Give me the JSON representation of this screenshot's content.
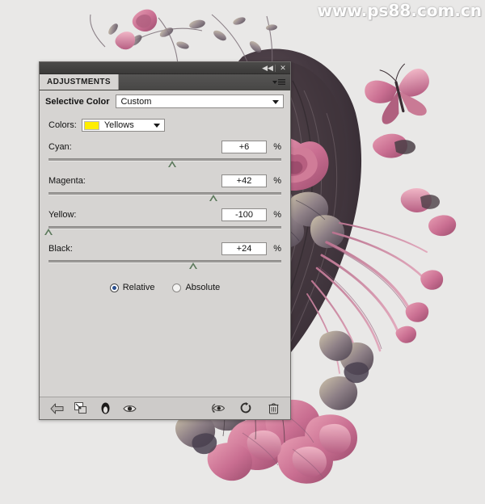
{
  "watermark": {
    "text": "www.ps88.com.cn"
  },
  "panel": {
    "titlebar": {
      "collapse_icon": "collapse-double-left-icon",
      "collapse_glyph": "◀◀",
      "close_icon": "close-icon",
      "close_glyph": "✕"
    },
    "tab": {
      "label": "ADJUSTMENTS"
    },
    "menu": {
      "name": "panel-menu-icon"
    },
    "adjustment": {
      "title": "Selective Color",
      "preset_value": "Custom",
      "preset_placeholder": "Custom"
    },
    "colors": {
      "label": "Colors:",
      "value": "Yellows",
      "swatch_color": "#ffee00"
    },
    "sliders": [
      {
        "label": "Cyan:",
        "value": "+6",
        "unit": "%",
        "percent": 53
      },
      {
        "label": "Magenta:",
        "value": "+42",
        "unit": "%",
        "percent": 71
      },
      {
        "label": "Yellow:",
        "value": "-100",
        "unit": "%",
        "percent": 0
      },
      {
        "label": "Black:",
        "value": "+24",
        "unit": "%",
        "percent": 62
      }
    ],
    "method": {
      "relative_label": "Relative",
      "absolute_label": "Absolute",
      "selected": "Relative"
    },
    "footer_buttons": [
      {
        "name": "return-to-adjustment-list-button",
        "icon": "back-arrow-icon"
      },
      {
        "name": "clip-to-layer-button",
        "icon": "clip-to-layer-icon"
      },
      {
        "name": "toggle-layer-mask-button",
        "icon": "mask-ellipse-icon"
      },
      {
        "name": "toggle-layer-visibility-button",
        "icon": "eye-icon"
      },
      {
        "name": "view-previous-state-button",
        "icon": "previous-state-eye-icon"
      },
      {
        "name": "reset-adjustment-button",
        "icon": "reset-circular-arrow-icon"
      },
      {
        "name": "delete-adjustment-button",
        "icon": "trash-icon"
      }
    ]
  }
}
